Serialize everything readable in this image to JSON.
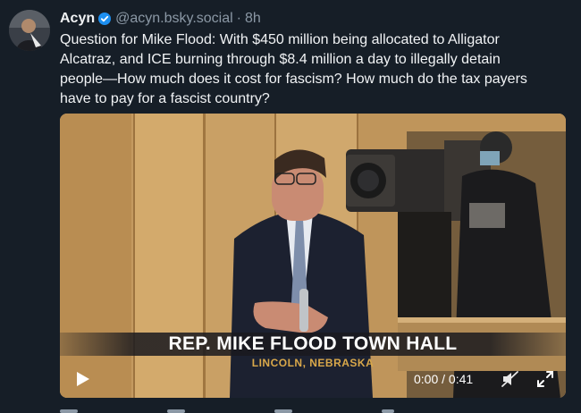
{
  "post": {
    "author_name": "Acyn",
    "handle": "@acyn.bsky.social",
    "separator": "·",
    "time": "8h",
    "text_lines": [
      "Question for Mike Flood: With $450 million being allocated to Alligator",
      "Alcatraz, and ICE burning through $8.4 million a day to illegally detain",
      "people—How much does it cost for fascism? How much do the tax payers",
      "have to pay for a fascist country?"
    ]
  },
  "video": {
    "lower_third_title": "REP. MIKE FLOOD TOWN HALL",
    "lower_third_subtitle": "LINCOLN, NEBRASKA",
    "timecode": "0:00 / 0:41"
  },
  "colors": {
    "background": "#161e27",
    "verified_badge": "#1d8ff0",
    "muted_text": "#8b98a5",
    "subtitle_gold": "#d9a84a"
  },
  "icons": [
    "verified-badge-icon",
    "play-icon",
    "mute-icon",
    "fullscreen-icon"
  ]
}
